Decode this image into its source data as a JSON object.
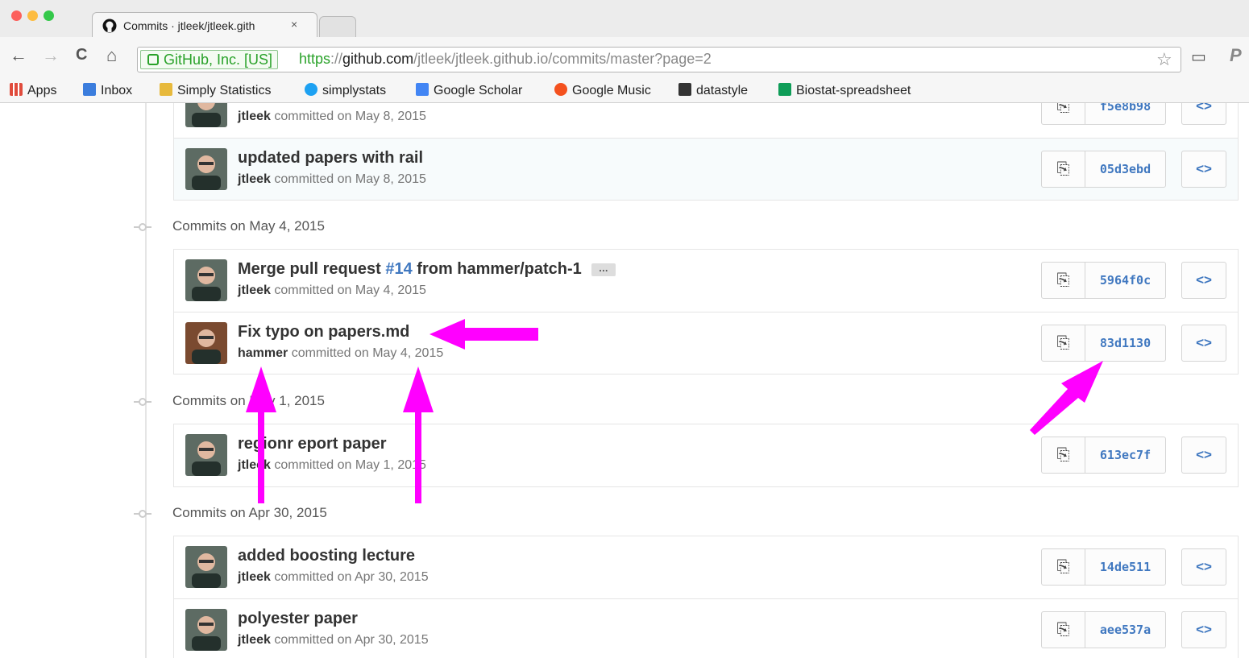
{
  "browser": {
    "tab_title": "Commits · jtleek/jtleek.gith",
    "tab_close": "×",
    "back_icon": "←",
    "forward_icon": "→",
    "reload_icon": "C",
    "home_icon": "⌂",
    "secure_label": "GitHub, Inc. [US]",
    "url_scheme": "https",
    "url_sep": "://",
    "url_host": "github.com",
    "url_path": "/jtleek/jtleek.github.io/commits/master?page=2",
    "star_icon": "☆",
    "cast_icon": "▭",
    "ext_icon": "P",
    "bookmarks": [
      "Apps",
      "Inbox",
      "Simply Statistics",
      "simplystats",
      "Google Scholar",
      "Google Music",
      "datastyle",
      "Biostat-spreadsheet"
    ]
  },
  "groups": [
    {
      "title": "",
      "commits": [
        {
          "title": "",
          "author": "jtleek",
          "date": "committed on May 8, 2015",
          "sha": "f5e8b98"
        },
        {
          "title": "updated papers with rail",
          "author": "jtleek",
          "date": "committed on May 8, 2015",
          "sha": "05d3ebd"
        }
      ]
    },
    {
      "title": "Commits on May 4, 2015",
      "commits": [
        {
          "title_pre": "Merge pull request ",
          "title_link": "#14",
          "title_post": " from hammer/patch-1",
          "ellipsis": "…",
          "author": "jtleek",
          "date": "committed on May 4, 2015",
          "sha": "5964f0c"
        },
        {
          "title": "Fix typo on papers.md",
          "author": "hammer",
          "date": "committed on May 4, 2015",
          "sha": "83d1130"
        }
      ]
    },
    {
      "title": "Commits on May 1, 2015",
      "commits": [
        {
          "title": "regionr eport paper",
          "author": "jtleek",
          "date": "committed on May 1, 2015",
          "sha": "613ec7f"
        }
      ]
    },
    {
      "title": "Commits on Apr 30, 2015",
      "commits": [
        {
          "title": "added boosting lecture",
          "author": "jtleek",
          "date": "committed on Apr 30, 2015",
          "sha": "14de511"
        },
        {
          "title": "polyester paper",
          "author": "jtleek",
          "date": "committed on Apr 30, 2015",
          "sha": "aee537a"
        }
      ]
    }
  ],
  "buttons": {
    "copy_icon": "⎘",
    "browse_label": "<>"
  },
  "colors": {
    "annotation": "#ff00ff",
    "link": "#4078c0",
    "secure": "#2aa22a"
  }
}
